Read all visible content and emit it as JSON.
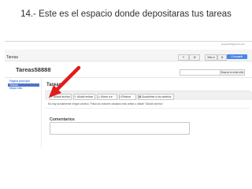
{
  "slide": {
    "title": "14.- Este es el espacio donde depositaras tus tareas"
  },
  "sites_bar": {
    "app_title": "Tareas",
    "account": "jorge2379@gmail.com",
    "edit_icon": "pencil-icon",
    "new_page_icon": "new-page-icon",
    "more_label": "Más",
    "settings_icon": "gear-icon",
    "share_label": "Compartir"
  },
  "site": {
    "name": "Tareas58888",
    "search_button": "Buscar en este sitio"
  },
  "sidebar": {
    "items": [
      {
        "label": "Página principal"
      },
      {
        "label": "Tareas"
      },
      {
        "label": "Mapa sitio"
      }
    ]
  },
  "page": {
    "title": "Tareas",
    "actions": [
      {
        "label": "Añadir archivo",
        "icon": "add-file-icon"
      },
      {
        "label": "Añadir enlace",
        "icon": "add-link-icon"
      },
      {
        "label": "Mover a",
        "icon": "folder-icon"
      },
      {
        "label": "Eliminar",
        "icon": "trash-icon"
      },
      {
        "label": "Suscribirse a los cambios",
        "icon": "subscribe-icon"
      }
    ],
    "empty_message": "No hay actualmente ningún archivo. Pulsa los botones situados más arriba o añadir \"Añadir archivo\".",
    "comments_title": "Comentarios"
  },
  "colors": {
    "accent": "#4a86e8",
    "sidebar_active": "#4d74c9",
    "arrow": "#e21b1b"
  }
}
